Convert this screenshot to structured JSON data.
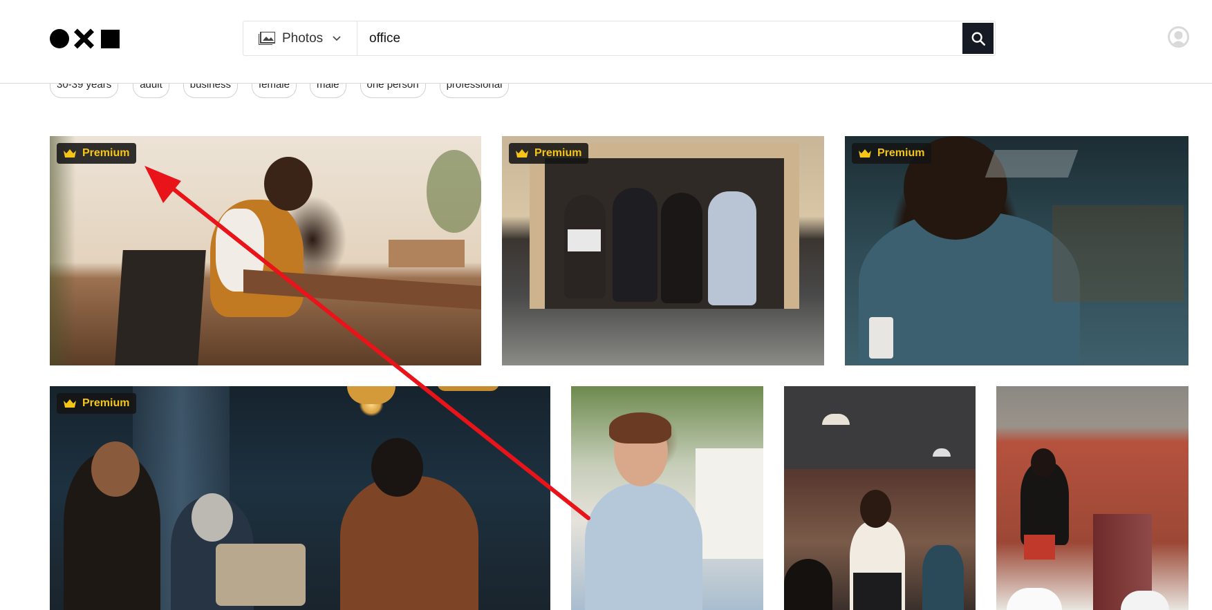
{
  "header": {
    "logo_icons": [
      "circle-icon",
      "cross-icon",
      "square-icon"
    ],
    "search": {
      "type_label": "Photos",
      "query": "office"
    }
  },
  "tags": [
    "30-39 years",
    "adult",
    "business",
    "female",
    "male",
    "one person",
    "professional"
  ],
  "photos": [
    {
      "badge": "Premium"
    },
    {
      "badge": "Premium"
    },
    {
      "badge": "Premium"
    },
    {
      "badge": "Premium"
    },
    {
      "badge": ""
    },
    {
      "badge": ""
    },
    {
      "badge": ""
    }
  ],
  "colors": {
    "search_button": "#151a24",
    "badge_text": "#f5c518",
    "annotation_arrow": "#e8141a"
  }
}
